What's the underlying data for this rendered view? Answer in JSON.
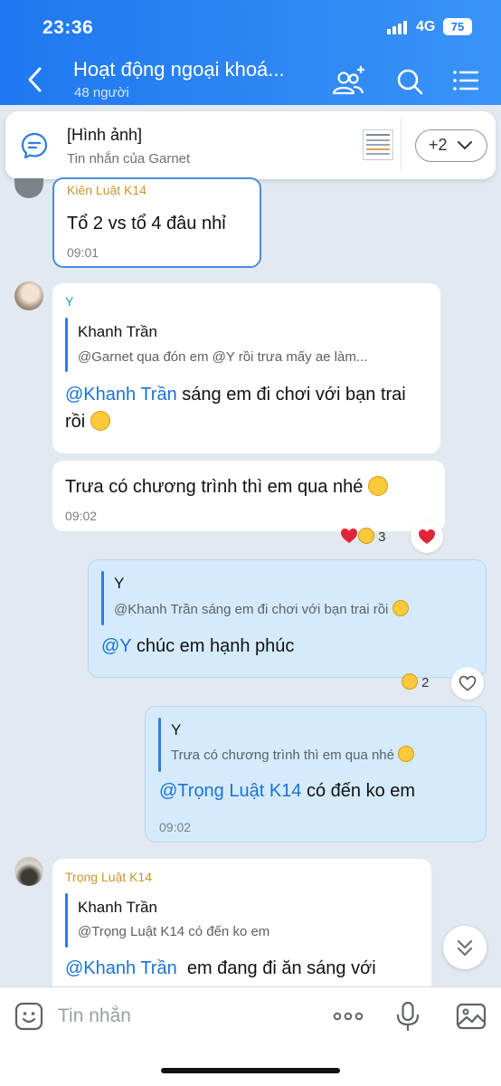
{
  "status_bar": {
    "time": "23:36",
    "network": "4G",
    "battery": "75"
  },
  "header": {
    "title": "Hoạt động ngoại khoá...",
    "subtitle": "48 người"
  },
  "pinned": {
    "title": "[Hình ảnh]",
    "subtitle": "Tin nhắn của Garnet",
    "more_label": "+2"
  },
  "messages": [
    {
      "sender": "Kiên Luật K14",
      "text": "Tổ 2 vs tổ 4 đâu nhỉ",
      "time": "09:01"
    },
    {
      "sender": "Y",
      "quote_name": "Khanh Trần",
      "quote_text": "@Garnet qua đón em @Y rồi trưa mấy ae làm...",
      "mention": "@Khanh Trần",
      "text": " sáng em đi chơi với bạn trai rồi"
    },
    {
      "text": "Trưa có chương trình thì em qua nhé",
      "time": "09:02",
      "reaction_count": "3"
    },
    {
      "quote_name": "Y",
      "quote_text": "@Khanh Trần sáng em đi chơi với bạn trai rồi",
      "mention": "@Y",
      "text": " chúc em hạnh phúc",
      "reaction_count": "2"
    },
    {
      "quote_name": "Y",
      "quote_text": "Trưa có chương trình thì em qua nhé",
      "mention": "@Trọng Luật K14",
      "text": " có đến ko em",
      "time": "09:02"
    },
    {
      "sender": "Trọng Luật K14",
      "quote_name": "Khanh Trần",
      "quote_text": "@Trọng Luật K14 có đến ko em",
      "mention": "@Khanh Trần",
      "text": "  em đang đi ăn sáng với"
    }
  ],
  "input": {
    "placeholder": "Tin nhắn"
  },
  "colors": {
    "header": "#2586f4",
    "my_bubble": "#d5ebfd",
    "mention": "#1a73d9",
    "sender_name": "#c9962a"
  }
}
